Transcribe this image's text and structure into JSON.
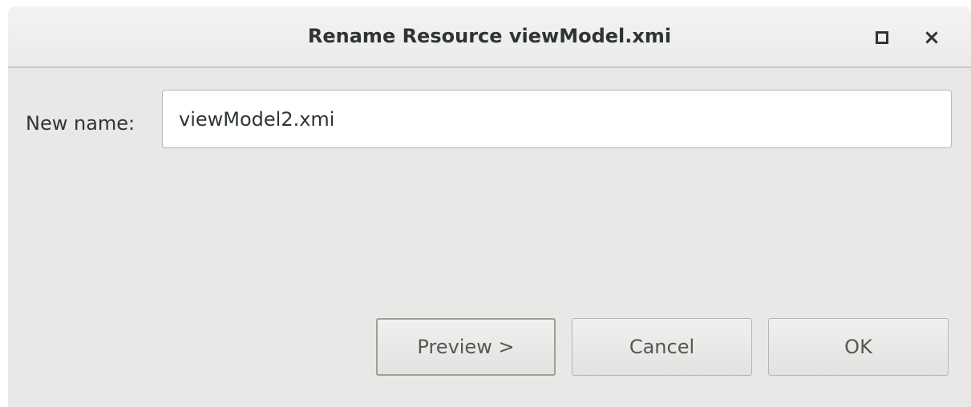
{
  "window": {
    "title": "Rename Resource viewModel.xmi",
    "controls": {
      "maximize_icon": "maximize-icon",
      "close_icon": "close-icon",
      "close_glyph": "×"
    }
  },
  "form": {
    "new_name_label": "New name:",
    "new_name_value": "viewModel2.xmi"
  },
  "buttons": {
    "preview": "Preview >",
    "cancel": "Cancel",
    "ok": "OK"
  },
  "colors": {
    "dialog_background": "#e8e8e7",
    "titlebar_background": "#f3f3f2",
    "text": "#2e3436"
  }
}
